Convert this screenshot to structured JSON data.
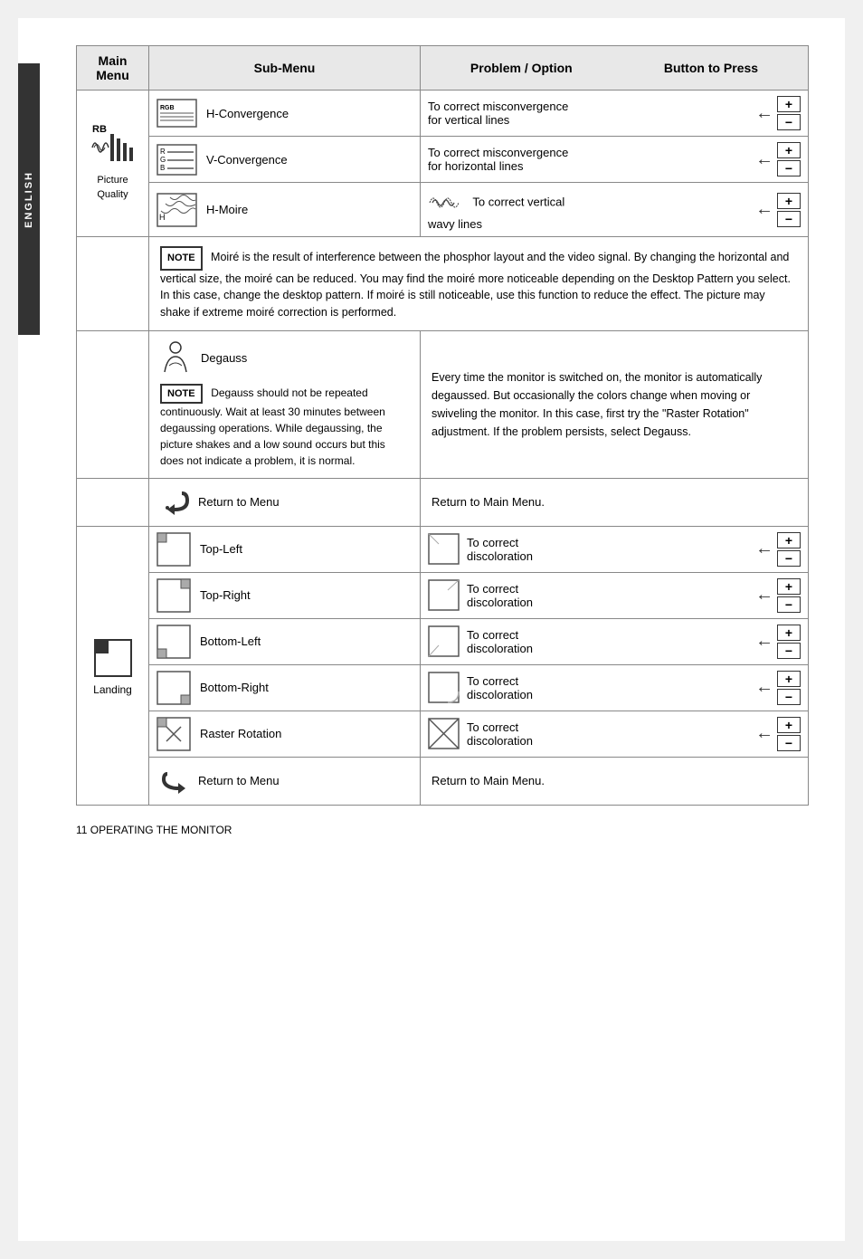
{
  "page": {
    "footer": "11   OPERATING THE MONITOR",
    "sidebar_label": "ENGLISH"
  },
  "header": {
    "col1": "Main Menu",
    "col2": "Sub-Menu",
    "col3": "Problem / Option",
    "col4": "Button to Press"
  },
  "rows": [
    {
      "main_menu": "RB\nPicture\nQuality",
      "sub_icon": "rgb-convergence",
      "sub_label": "H-Convergence",
      "problem": "To correct misconvergence\nfor vertical lines",
      "has_buttons": true
    },
    {
      "main_menu": "",
      "sub_icon": "v-convergence",
      "sub_label": "V-Convergence",
      "problem": "To correct misconvergence\nfor horizontal lines",
      "has_buttons": true
    },
    {
      "main_menu": "",
      "sub_icon": "h-moire",
      "sub_label": "H-Moire",
      "problem": "To correct vertical\nwavy lines",
      "has_buttons": true
    }
  ],
  "note": {
    "label": "NOTE",
    "text": "Moiré is the result of interference between the phosphor layout and the video signal. By changing the horizontal and vertical size, the moiré can be reduced. You may find the moiré more noticeable depending on the Desktop Pattern you select. In this case, change the desktop pattern. If moiré is still noticeable, use this function to reduce the effect. The picture may shake if extreme moiré correction is performed."
  },
  "degauss": {
    "label": "Degauss",
    "note_label": "NOTE",
    "note_text": "Degauss should not be repeated continuously. Wait at least 30 minutes between degaussing operations. While degaussing, the picture shakes and a low sound occurs but this does not indicate a problem, it is normal.",
    "problem_text": "Every time the monitor is switched on, the monitor is automatically degaussed. But occasionally the colors change when moving or swiveling the monitor. In this case, first try the \"Raster Rotation\" adjustment. If the problem persists, select Degauss."
  },
  "return_to_menu_1": {
    "label": "Return to Menu",
    "problem": "Return to Main Menu."
  },
  "landing": {
    "main_menu": "Landing",
    "items": [
      {
        "sub_icon": "top-left",
        "sub_label": "Top-Left",
        "problem": "To correct\ndiscoloration",
        "has_buttons": true
      },
      {
        "sub_icon": "top-right",
        "sub_label": "Top-Right",
        "problem": "To correct\ndiscoloration",
        "has_buttons": true
      },
      {
        "sub_icon": "bottom-left",
        "sub_label": "Bottom-Left",
        "problem": "To correct\ndiscoloration",
        "has_buttons": true
      },
      {
        "sub_icon": "bottom-right",
        "sub_label": "Bottom-Right",
        "problem": "To correct\ndiscoloration",
        "has_buttons": true
      },
      {
        "sub_icon": "raster-rotation",
        "sub_label": "Raster Rotation",
        "problem": "To correct\ndiscoloration",
        "has_buttons": true
      }
    ]
  },
  "return_to_menu_2": {
    "label": "Return to Menu",
    "problem": "Return to Main Menu."
  }
}
